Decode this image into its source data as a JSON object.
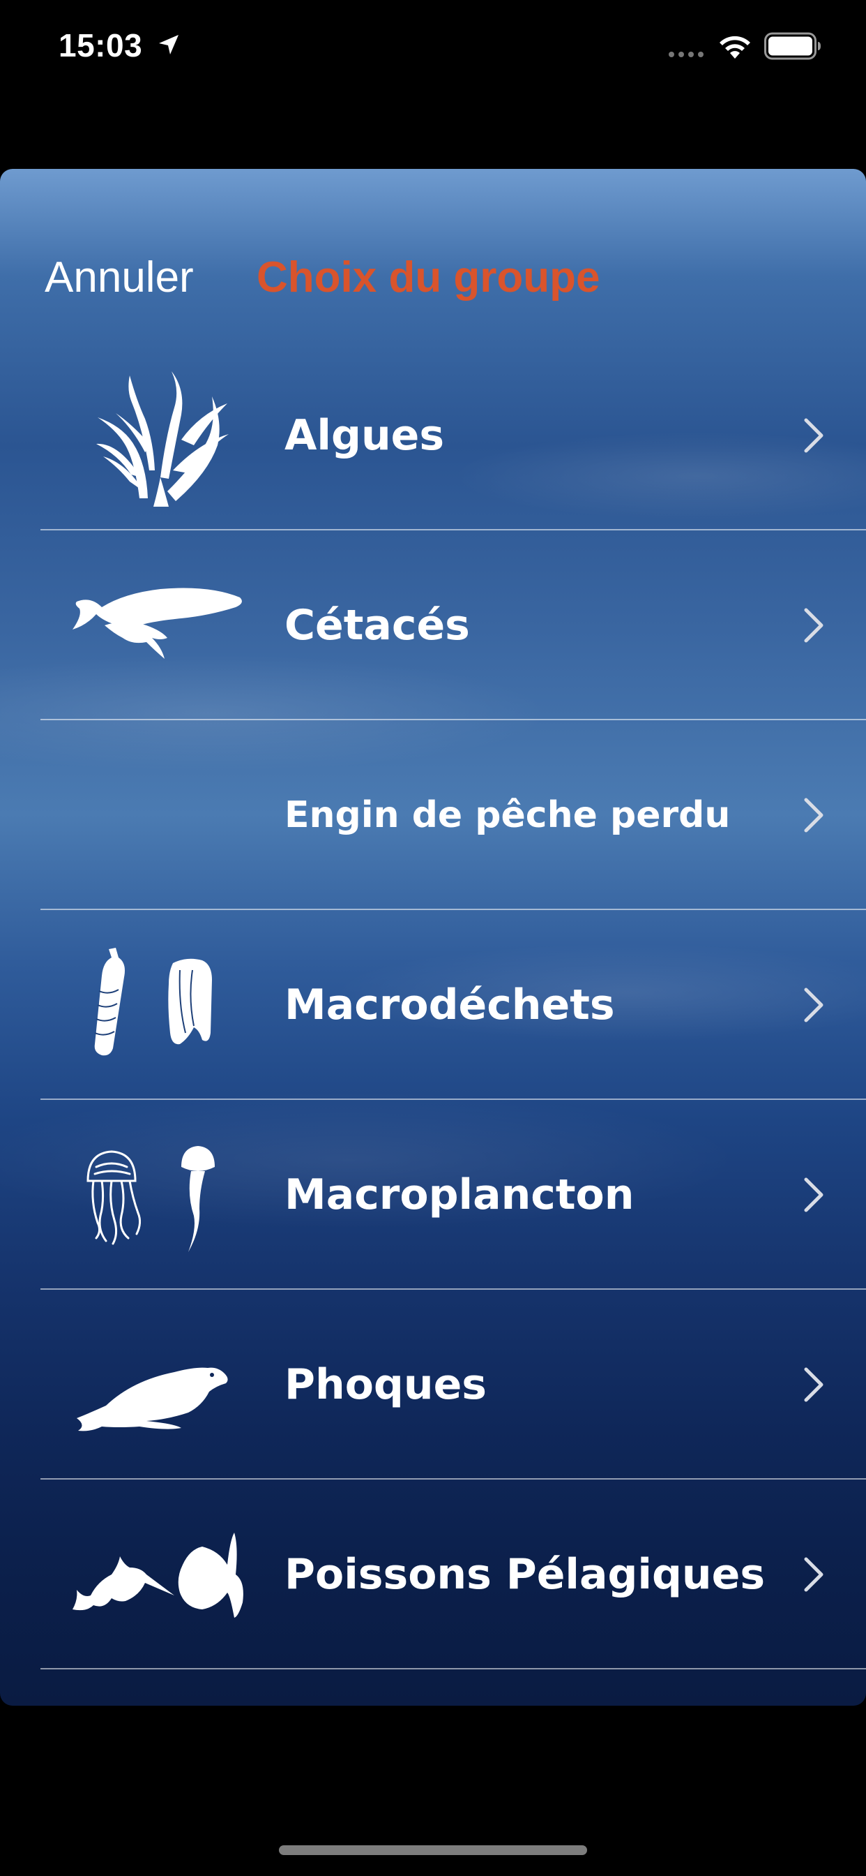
{
  "status_bar": {
    "time": "15:03",
    "icons": [
      "location-arrow-icon",
      "cellular-signal-icon",
      "wifi-icon",
      "battery-icon"
    ]
  },
  "nav": {
    "cancel_label": "Annuler",
    "title": "Choix du groupe",
    "title_color": "#d9542c"
  },
  "groups": [
    {
      "label": "Algues",
      "icon": "seaweed-icon"
    },
    {
      "label": "Cétacés",
      "icon": "whale-icon"
    },
    {
      "label": "Engin de pêche perdu",
      "icon": ""
    },
    {
      "label": "Macrodéchets",
      "icon": "bottle-bag-icon"
    },
    {
      "label": "Macroplancton",
      "icon": "jellyfish-icon"
    },
    {
      "label": "Phoques",
      "icon": "seal-icon"
    },
    {
      "label": "Poissons Pélagiques",
      "icon": "swordfish-sunfish-icon"
    }
  ]
}
